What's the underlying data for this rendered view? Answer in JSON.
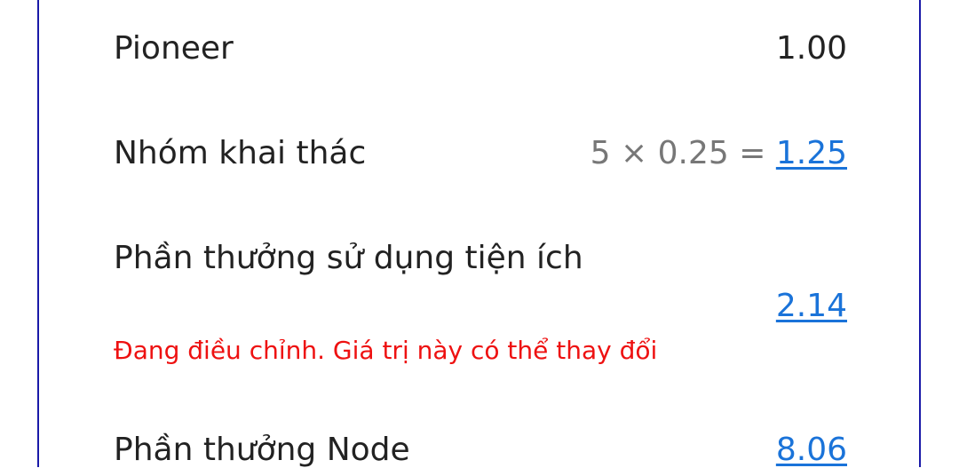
{
  "rows": {
    "pioneer": {
      "label": "Pioneer",
      "value": "1.00"
    },
    "mining_group": {
      "label": "Nhóm khai thác",
      "formula": "5 × 0.25 =",
      "value": "1.25"
    },
    "utility_reward": {
      "label": "Phần thưởng sử dụng tiện ích",
      "value": "2.14",
      "warning": "Đang điều chỉnh. Giá trị này có thể thay đổi"
    },
    "node_reward": {
      "label": "Phần thưởng Node",
      "value": "8.06"
    }
  },
  "colors": {
    "link": "#1a73d9",
    "warning": "#ee1111",
    "border": "#1a1aa8",
    "text": "#222222",
    "muted": "#777777"
  }
}
